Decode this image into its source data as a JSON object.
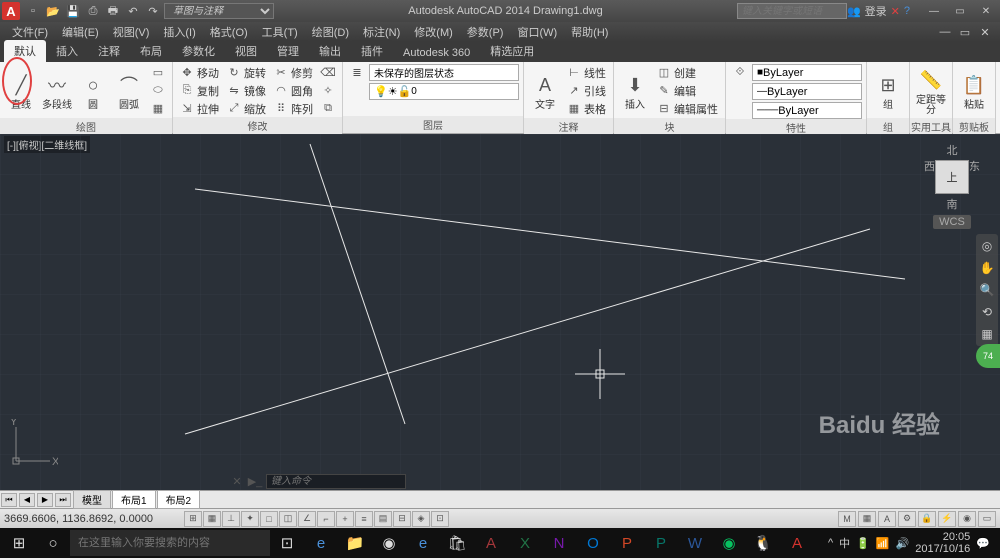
{
  "app": {
    "logo": "A",
    "title": "Autodesk AutoCAD 2014   Drawing1.dwg",
    "search_ph": "键入关键字或短语",
    "login": "登录",
    "workspace": "草图与注释"
  },
  "menubar": [
    "文件(F)",
    "编辑(E)",
    "视图(V)",
    "插入(I)",
    "格式(O)",
    "工具(T)",
    "绘图(D)",
    "标注(N)",
    "修改(M)",
    "参数(P)",
    "窗口(W)",
    "帮助(H)"
  ],
  "ribbon_tabs": [
    "默认",
    "插入",
    "注释",
    "布局",
    "参数化",
    "视图",
    "管理",
    "输出",
    "插件",
    "Autodesk 360",
    "精选应用"
  ],
  "panels": {
    "draw": {
      "title": "绘图",
      "line": "直线",
      "polyline": "多段线",
      "circle": "圆",
      "arc": "圆弧"
    },
    "modify": {
      "title": "修改",
      "move": "移动",
      "rotate": "旋转",
      "trim": "修剪",
      "copy": "复制",
      "mirror": "镜像",
      "fillet": "圆角",
      "stretch": "拉伸",
      "scale": "缩放",
      "array": "阵列"
    },
    "layers": {
      "title": "图层",
      "state": "未保存的图层状态"
    },
    "annot": {
      "title": "注释",
      "text": "文字",
      "linear": "线性",
      "leader": "引线",
      "table": "表格"
    },
    "block": {
      "title": "块",
      "insert": "插入",
      "create": "创建",
      "edit": "编辑",
      "attr": "编辑属性"
    },
    "props": {
      "title": "特性",
      "layer": "ByLayer"
    },
    "group": {
      "title": "组",
      "label": "组"
    },
    "util": {
      "title": "实用工具",
      "measure": "定距等分"
    },
    "clip": {
      "title": "剪贴板",
      "paste": "粘贴"
    }
  },
  "viewport": {
    "label": "[-][俯视][二维线框]"
  },
  "viewcube": {
    "n": "北",
    "s": "南",
    "e": "东",
    "w": "西",
    "top": "上",
    "wcs": "WCS"
  },
  "green_badge": "74",
  "ucs": {
    "x": "X",
    "y": "Y"
  },
  "cmd": {
    "ph": "键入命令"
  },
  "model_tabs": {
    "model": "模型",
    "l1": "布局1",
    "l2": "布局2"
  },
  "status": {
    "coords": "3669.6606, 1136.8692, 0.0000"
  },
  "taskbar": {
    "search_ph": "在这里输入你要搜索的内容",
    "time": "20:05",
    "date": "2017/10/16"
  },
  "watermark": "Baidu 经验"
}
